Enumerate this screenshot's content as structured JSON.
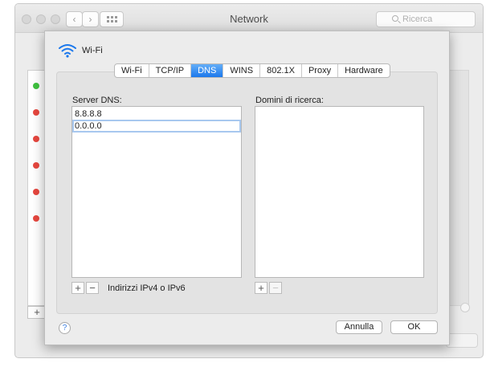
{
  "window": {
    "title": "Network",
    "search_placeholder": "Ricerca",
    "back_glyph": "‹",
    "forward_glyph": "›",
    "add_glyph": "+"
  },
  "sidebar_status": [
    "green",
    "red",
    "red",
    "red",
    "red",
    "red"
  ],
  "colors": {
    "green": "#3fc23f",
    "red": "#e7473f",
    "accent": "#1b78ec"
  },
  "sheet": {
    "title": "Wi-Fi",
    "icon": "wifi-icon",
    "tabs": [
      {
        "label": "Wi-Fi",
        "active": false
      },
      {
        "label": "TCP/IP",
        "active": false
      },
      {
        "label": "DNS",
        "active": true
      },
      {
        "label": "WINS",
        "active": false
      },
      {
        "label": "802.1X",
        "active": false
      },
      {
        "label": "Proxy",
        "active": false
      },
      {
        "label": "Hardware",
        "active": false
      }
    ],
    "dns": {
      "label": "Server DNS:",
      "servers": [
        "8.8.8.8",
        "0.0.0.0"
      ],
      "editing_index": 1,
      "add_glyph": "+",
      "remove_glyph": "−",
      "hint": "Indirizzi IPv4 o IPv6"
    },
    "search_domains": {
      "label": "Domini di ricerca:",
      "items": [],
      "add_glyph": "+",
      "remove_glyph": "−"
    },
    "help_glyph": "?",
    "cancel_label": "Annulla",
    "ok_label": "OK"
  }
}
